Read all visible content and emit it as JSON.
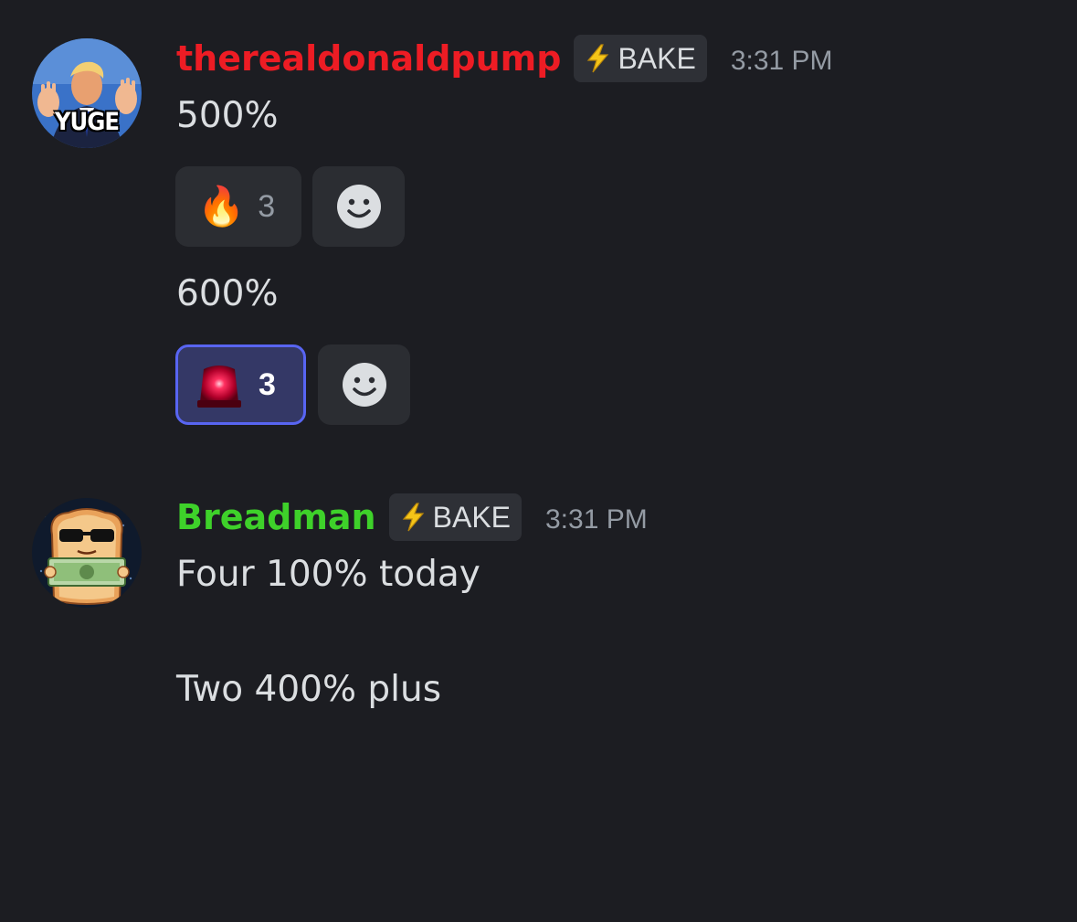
{
  "messages": [
    {
      "author": {
        "name": "therealdonaldpump",
        "color": "#ed1c24",
        "avatar_text": "YUGE",
        "avatar_icon": "avatar-trump-yuge"
      },
      "role_tag": {
        "icon": "lightning-bolt",
        "label": "BAKE"
      },
      "timestamp": "3:31 PM",
      "lines": [
        {
          "text": "500%",
          "reactions": [
            {
              "emoji": "fire",
              "glyph": "🔥",
              "count": "3",
              "active": false
            },
            {
              "emoji": "add-reaction",
              "glyph": "",
              "count": "",
              "active": false
            }
          ]
        },
        {
          "text": "600%",
          "reactions": [
            {
              "emoji": "red-siren",
              "glyph": "",
              "count": "3",
              "active": true
            },
            {
              "emoji": "add-reaction",
              "glyph": "",
              "count": "",
              "active": false
            }
          ]
        }
      ]
    },
    {
      "author": {
        "name": "Breadman",
        "color": "#3ed12a",
        "avatar_icon": "avatar-bread-sunglasses-money"
      },
      "role_tag": {
        "icon": "lightning-bolt",
        "label": "BAKE"
      },
      "timestamp": "3:31 PM",
      "lines": [
        {
          "text": "Four 100% today"
        },
        {
          "text": "Two 400% plus"
        }
      ]
    }
  ],
  "colors": {
    "background": "#1c1d22",
    "text": "#dbdee1",
    "muted": "#949ba4",
    "reaction_bg": "#2b2d32",
    "reaction_active_bg": "#343866",
    "reaction_active_border": "#5865f2"
  }
}
